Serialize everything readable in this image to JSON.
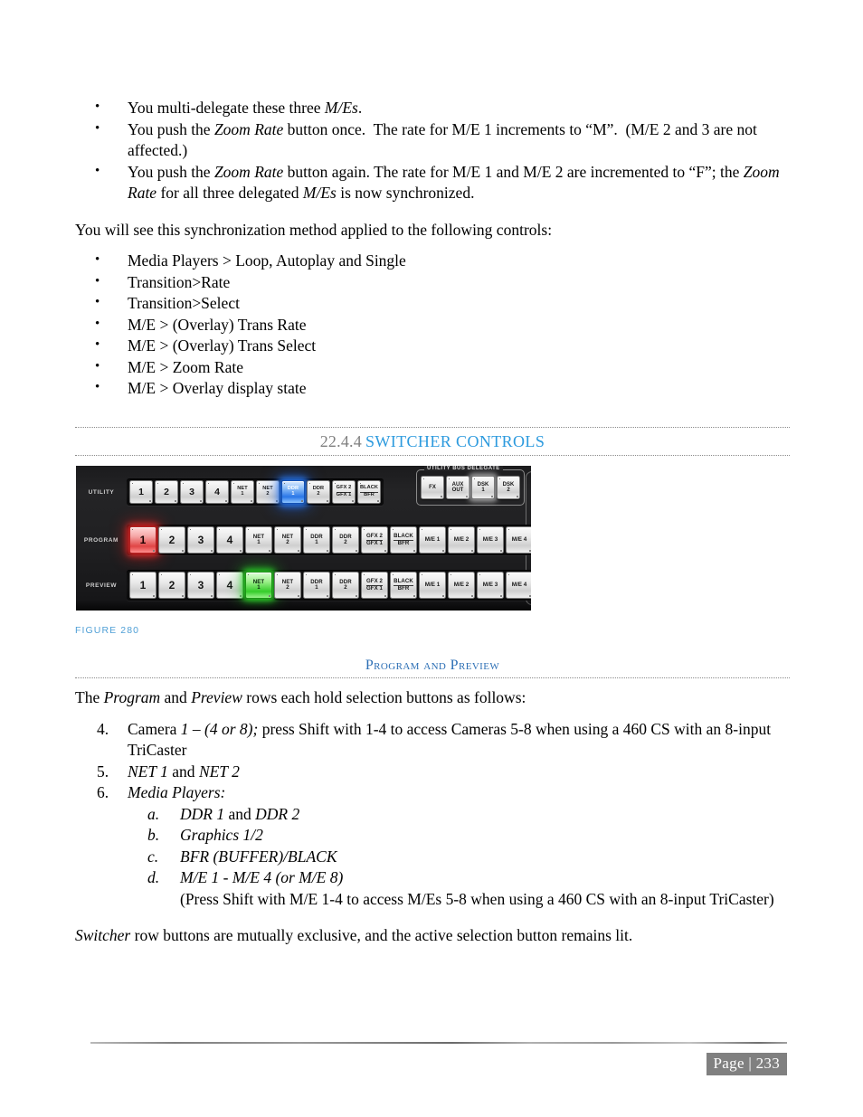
{
  "intro_bullets": [
    "You multi-delegate these three M/Es.",
    "You push the Zoom Rate button once.  The rate for M/E 1 increments to “M”.  (M/E 2 and 3 are not affected.)",
    "You push the Zoom Rate button again. The rate for M/E 1 and M/E 2 are incremented to “F”; the Zoom Rate for all three delegated M/Es is now synchronized."
  ],
  "sync_paragraph": "You will see this synchronization method applied to the following controls:",
  "control_bullets": [
    "Media Players > Loop, Autoplay and Single",
    "Transition>Rate",
    "Transition>Select",
    "M/E > (Overlay) Trans Rate",
    "M/E > (Overlay) Trans Select",
    "M/E > Zoom Rate",
    "M/E > Overlay display state"
  ],
  "section_heading": {
    "number": "22.4.4",
    "title": "SWITCHER CONTROLS",
    "number_color": "#7f7f7f",
    "title_color": "#2c9ade"
  },
  "figure": {
    "caption": "FIGURE 280",
    "caption_color": "#4f9fd6",
    "delegate_group_label": "UTILITY BUS DELEGATE",
    "rows": [
      {
        "label": "UTILITY",
        "buttons": [
          {
            "l1": "1",
            "l2": "",
            "state": "off",
            "kind": "num"
          },
          {
            "l1": "2",
            "l2": "",
            "state": "off",
            "kind": "num"
          },
          {
            "l1": "3",
            "l2": "",
            "state": "off",
            "kind": "num"
          },
          {
            "l1": "4",
            "l2": "",
            "state": "off",
            "kind": "num"
          },
          {
            "l1": "NET",
            "l2": "1",
            "state": "off",
            "kind": "small-text"
          },
          {
            "l1": "NET",
            "l2": "2",
            "state": "off",
            "kind": "small-text"
          },
          {
            "l1": "DDR",
            "l2": "1",
            "state": "blue",
            "kind": "small-text"
          },
          {
            "l1": "DDR",
            "l2": "2",
            "state": "off",
            "kind": "small-text"
          },
          {
            "l1": "GFX 2",
            "l2": "GFX 1",
            "state": "off",
            "kind": "small-text stacked"
          },
          {
            "l1": "BLACK",
            "l2": "BFR",
            "state": "off",
            "kind": "small-text stacked"
          }
        ]
      },
      {
        "label": "PROGRAM",
        "buttons": [
          {
            "l1": "1",
            "l2": "",
            "state": "red",
            "kind": "num"
          },
          {
            "l1": "2",
            "l2": "",
            "state": "off",
            "kind": "num"
          },
          {
            "l1": "3",
            "l2": "",
            "state": "off",
            "kind": "num"
          },
          {
            "l1": "4",
            "l2": "",
            "state": "off",
            "kind": "num"
          },
          {
            "l1": "NET",
            "l2": "1",
            "state": "off",
            "kind": "small-text"
          },
          {
            "l1": "NET",
            "l2": "2",
            "state": "off",
            "kind": "small-text"
          },
          {
            "l1": "DDR",
            "l2": "1",
            "state": "off",
            "kind": "small-text"
          },
          {
            "l1": "DDR",
            "l2": "2",
            "state": "off",
            "kind": "small-text"
          },
          {
            "l1": "GFX 2",
            "l2": "GFX 1",
            "state": "off",
            "kind": "small-text stacked"
          },
          {
            "l1": "BLACK",
            "l2": "BFR",
            "state": "off",
            "kind": "small-text stacked"
          },
          {
            "l1": "M/E 1",
            "l2": "",
            "state": "off",
            "kind": "me"
          },
          {
            "l1": "M/E 2",
            "l2": "",
            "state": "off",
            "kind": "me"
          },
          {
            "l1": "M/E 3",
            "l2": "",
            "state": "off",
            "kind": "me"
          },
          {
            "l1": "M/E 4",
            "l2": "",
            "state": "off",
            "kind": "me"
          }
        ]
      },
      {
        "label": "PREVIEW",
        "buttons": [
          {
            "l1": "1",
            "l2": "",
            "state": "off",
            "kind": "num"
          },
          {
            "l1": "2",
            "l2": "",
            "state": "off",
            "kind": "num"
          },
          {
            "l1": "3",
            "l2": "",
            "state": "off",
            "kind": "num"
          },
          {
            "l1": "4",
            "l2": "",
            "state": "off",
            "kind": "num"
          },
          {
            "l1": "NET",
            "l2": "1",
            "state": "green",
            "kind": "small-text"
          },
          {
            "l1": "NET",
            "l2": "2",
            "state": "off",
            "kind": "small-text"
          },
          {
            "l1": "DDR",
            "l2": "1",
            "state": "off",
            "kind": "small-text"
          },
          {
            "l1": "DDR",
            "l2": "2",
            "state": "off",
            "kind": "small-text"
          },
          {
            "l1": "GFX 2",
            "l2": "GFX 1",
            "state": "off",
            "kind": "small-text stacked"
          },
          {
            "l1": "BLACK",
            "l2": "BFR",
            "state": "off",
            "kind": "small-text stacked"
          },
          {
            "l1": "M/E 1",
            "l2": "",
            "state": "off",
            "kind": "me"
          },
          {
            "l1": "M/E 2",
            "l2": "",
            "state": "off",
            "kind": "me"
          },
          {
            "l1": "M/E 3",
            "l2": "",
            "state": "off",
            "kind": "me"
          },
          {
            "l1": "M/E 4",
            "l2": "",
            "state": "off",
            "kind": "me"
          }
        ]
      }
    ],
    "delegate_buttons": [
      {
        "l1": "FX",
        "l2": "",
        "state": "off"
      },
      {
        "l1": "AUX",
        "l2": "OUT",
        "state": "off"
      },
      {
        "l1": "DSK",
        "l2": "1",
        "state": "white"
      },
      {
        "l1": "DSK",
        "l2": "2",
        "state": "off"
      }
    ]
  },
  "subheading": {
    "title": "Program and Preview",
    "color": "#2c6fb5"
  },
  "program_preview_intro": "The Program and Preview rows each hold selection buttons as follows:",
  "numbered_list": [
    {
      "marker": "4.",
      "text": "Camera 1 – (4 or 8); press Shift with 1-4 to access Cameras 5-8 when using a 460 CS with an 8-input TriCaster"
    },
    {
      "marker": "5.",
      "text": "NET 1 and NET 2"
    },
    {
      "marker": "6.",
      "text": "Media Players:"
    }
  ],
  "alpha_list": [
    {
      "marker": "a.",
      "text": "DDR 1 and DDR 2"
    },
    {
      "marker": "b.",
      "text": "Graphics 1/2"
    },
    {
      "marker": "c.",
      "text": "BFR (BUFFER)/BLACK"
    },
    {
      "marker": "d.",
      "text": "M/E 1 - M/E 4 (or M/E 8)"
    }
  ],
  "alpha_note": "(Press Shift with M/E 1-4 to access M/Es 5-8 when using a 460 CS with an 8-input TriCaster)",
  "closing_paragraph": "Switcher row buttons are mutually exclusive, and the active selection button remains lit.",
  "footer": {
    "page_label": "Page | 233"
  }
}
